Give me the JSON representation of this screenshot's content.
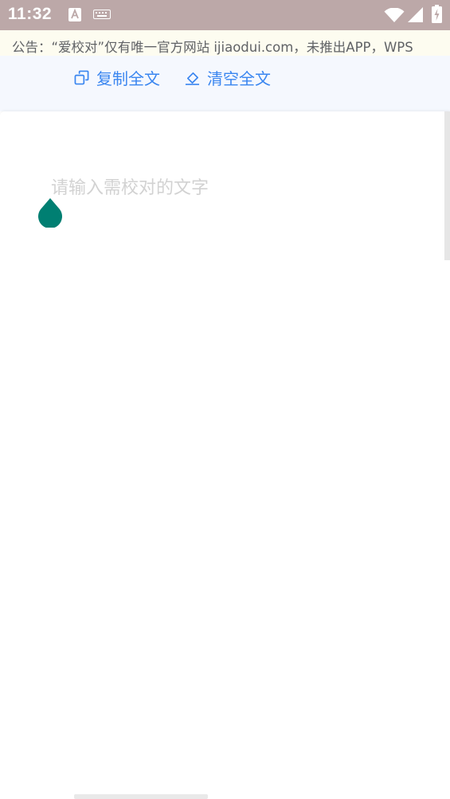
{
  "status_bar": {
    "time": "11:32",
    "icons": [
      "text-a-icon",
      "keyboard-icon",
      "wifi-icon",
      "signal-icon",
      "battery-charging-icon"
    ]
  },
  "notice": {
    "text": "公告：“爱校对”仅有唯一官方网站 ijiaodui.com，未推出APP，WPS"
  },
  "toolbar": {
    "copy_label": "复制全文",
    "clear_label": "清空全文",
    "copy_icon": "copy-icon",
    "clear_icon": "eraser-icon"
  },
  "editor": {
    "placeholder": "请输入需校对的文字",
    "value": ""
  },
  "colors": {
    "status_bar": "#bca8a8",
    "notice_bg": "#fdfcf0",
    "accent": "#3a86f0",
    "cursor_handle": "#007f72"
  }
}
